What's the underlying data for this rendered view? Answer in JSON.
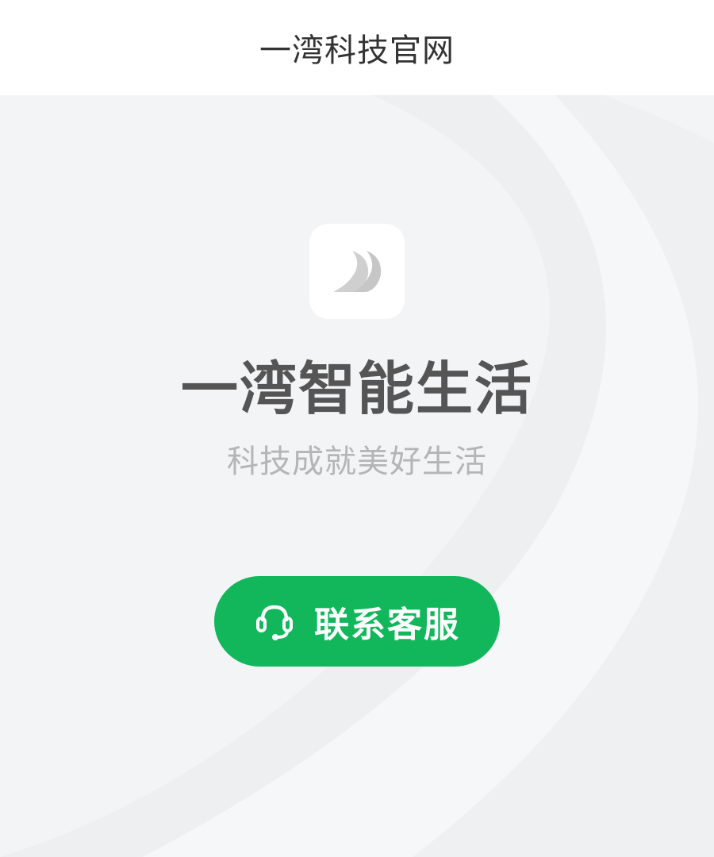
{
  "header": {
    "title": "一湾科技官网"
  },
  "app": {
    "logo_icon": "brand-logo-icon",
    "name": "一湾智能生活",
    "slogan": "科技成就美好生活"
  },
  "contact_button": {
    "label": "联系客服",
    "icon": "headset-icon"
  },
  "colors": {
    "header_bg": "#ffffff",
    "page_bg": "#f3f4f6",
    "accent": "#12b75c",
    "title_text": "#555555",
    "slogan_text": "#b5b5b5"
  }
}
